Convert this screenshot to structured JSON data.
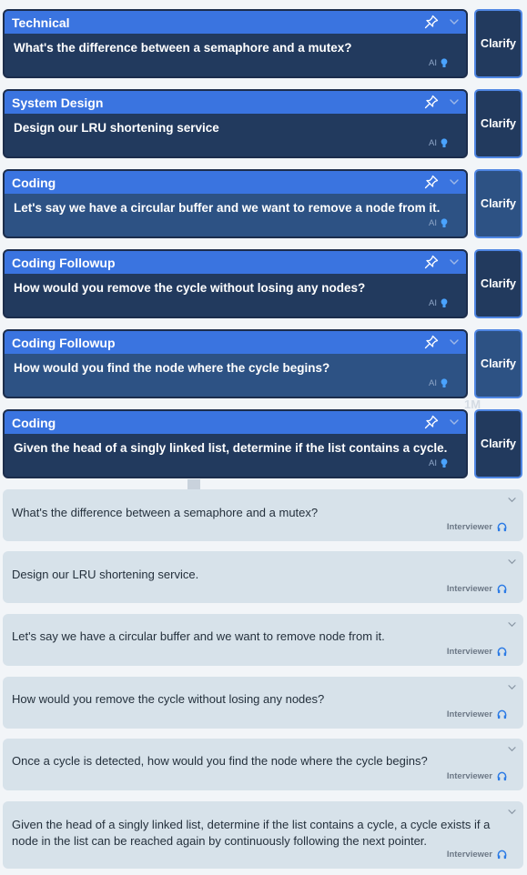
{
  "clarify_label": "Clarify",
  "ai_label": "AI",
  "interviewer_label": "Interviewer",
  "ghost_text": "1M",
  "colors": {
    "header_blue": "#3a74e0",
    "card_dark": "#223a5e",
    "card_light": "#2d5284",
    "accent": "#2c7be5"
  },
  "questions": [
    {
      "category": "Technical",
      "text": "What's the difference between a semaphore and a mutex?",
      "shade": "dark"
    },
    {
      "category": "System Design",
      "text": "Design our LRU shortening service",
      "shade": "dark"
    },
    {
      "category": "Coding",
      "text": "Let's say we have a circular buffer and we want to remove a node from it.",
      "shade": "light"
    },
    {
      "category": "Coding Followup",
      "text": "How would you remove the cycle without losing any nodes?",
      "shade": "dark"
    },
    {
      "category": "Coding Followup",
      "text": "How would you find the node where the cycle begins?",
      "shade": "light"
    },
    {
      "category": "Coding",
      "text": "Given the head of a singly linked list, determine if the list contains a cycle.",
      "shade": "dark"
    }
  ],
  "transcripts": [
    {
      "text": "What's the difference between a semaphore and a mutex?"
    },
    {
      "text": "Design our LRU shortening service."
    },
    {
      "text": "Let's say we have a circular buffer and we want to remove node from it."
    },
    {
      "text": "How would you remove the cycle without losing any nodes?"
    },
    {
      "text": "Once a cycle is detected, how would you find the node where the cycle begins?"
    },
    {
      "text": "Given the head of a singly linked list, determine if the list contains a cycle, a cycle exists if a node in the list can be reached again by continuously following the next pointer."
    }
  ]
}
